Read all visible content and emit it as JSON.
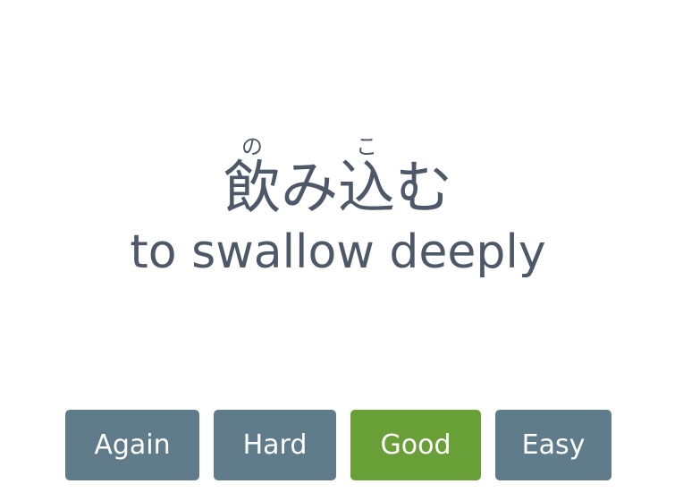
{
  "card": {
    "term_parts": [
      {
        "base": "飲",
        "reading": "の"
      },
      {
        "base": "み",
        "reading": ""
      },
      {
        "base": "込",
        "reading": "こ"
      },
      {
        "base": "む",
        "reading": ""
      }
    ],
    "meaning": "to swallow deeply"
  },
  "buttons": {
    "again": "Again",
    "hard": "Hard",
    "good": "Good",
    "easy": "Easy"
  },
  "colors": {
    "text": "#4d5968",
    "button_default": "#607b8a",
    "button_good": "#68a037",
    "button_text": "#ffffff",
    "background": "#ffffff"
  }
}
